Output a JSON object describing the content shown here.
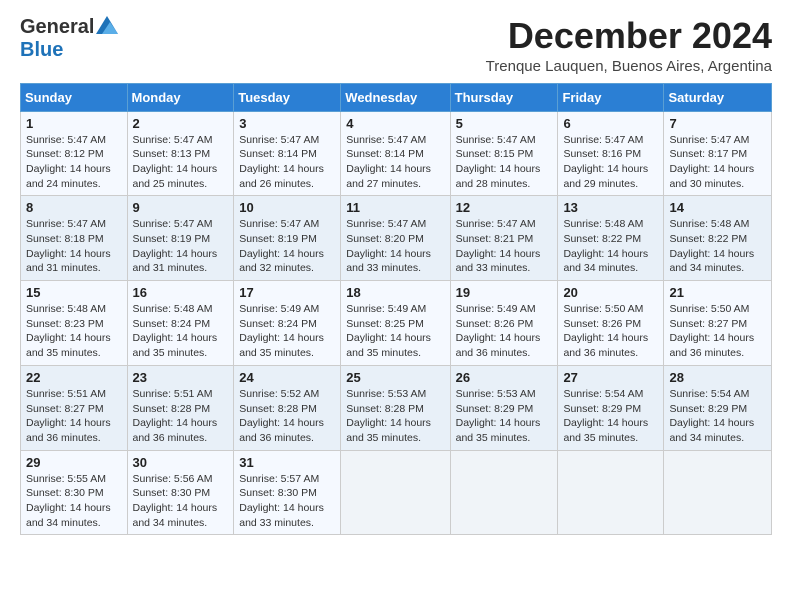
{
  "header": {
    "logo_general": "General",
    "logo_blue": "Blue",
    "title": "December 2024",
    "location": "Trenque Lauquen, Buenos Aires, Argentina"
  },
  "calendar": {
    "days_of_week": [
      "Sunday",
      "Monday",
      "Tuesday",
      "Wednesday",
      "Thursday",
      "Friday",
      "Saturday"
    ],
    "weeks": [
      [
        {
          "day": "1",
          "sunrise": "5:47 AM",
          "sunset": "8:12 PM",
          "daylight": "14 hours and 24 minutes."
        },
        {
          "day": "2",
          "sunrise": "5:47 AM",
          "sunset": "8:13 PM",
          "daylight": "14 hours and 25 minutes."
        },
        {
          "day": "3",
          "sunrise": "5:47 AM",
          "sunset": "8:14 PM",
          "daylight": "14 hours and 26 minutes."
        },
        {
          "day": "4",
          "sunrise": "5:47 AM",
          "sunset": "8:14 PM",
          "daylight": "14 hours and 27 minutes."
        },
        {
          "day": "5",
          "sunrise": "5:47 AM",
          "sunset": "8:15 PM",
          "daylight": "14 hours and 28 minutes."
        },
        {
          "day": "6",
          "sunrise": "5:47 AM",
          "sunset": "8:16 PM",
          "daylight": "14 hours and 29 minutes."
        },
        {
          "day": "7",
          "sunrise": "5:47 AM",
          "sunset": "8:17 PM",
          "daylight": "14 hours and 30 minutes."
        }
      ],
      [
        {
          "day": "8",
          "sunrise": "5:47 AM",
          "sunset": "8:18 PM",
          "daylight": "14 hours and 31 minutes."
        },
        {
          "day": "9",
          "sunrise": "5:47 AM",
          "sunset": "8:19 PM",
          "daylight": "14 hours and 31 minutes."
        },
        {
          "day": "10",
          "sunrise": "5:47 AM",
          "sunset": "8:19 PM",
          "daylight": "14 hours and 32 minutes."
        },
        {
          "day": "11",
          "sunrise": "5:47 AM",
          "sunset": "8:20 PM",
          "daylight": "14 hours and 33 minutes."
        },
        {
          "day": "12",
          "sunrise": "5:47 AM",
          "sunset": "8:21 PM",
          "daylight": "14 hours and 33 minutes."
        },
        {
          "day": "13",
          "sunrise": "5:48 AM",
          "sunset": "8:22 PM",
          "daylight": "14 hours and 34 minutes."
        },
        {
          "day": "14",
          "sunrise": "5:48 AM",
          "sunset": "8:22 PM",
          "daylight": "14 hours and 34 minutes."
        }
      ],
      [
        {
          "day": "15",
          "sunrise": "5:48 AM",
          "sunset": "8:23 PM",
          "daylight": "14 hours and 35 minutes."
        },
        {
          "day": "16",
          "sunrise": "5:48 AM",
          "sunset": "8:24 PM",
          "daylight": "14 hours and 35 minutes."
        },
        {
          "day": "17",
          "sunrise": "5:49 AM",
          "sunset": "8:24 PM",
          "daylight": "14 hours and 35 minutes."
        },
        {
          "day": "18",
          "sunrise": "5:49 AM",
          "sunset": "8:25 PM",
          "daylight": "14 hours and 35 minutes."
        },
        {
          "day": "19",
          "sunrise": "5:49 AM",
          "sunset": "8:26 PM",
          "daylight": "14 hours and 36 minutes."
        },
        {
          "day": "20",
          "sunrise": "5:50 AM",
          "sunset": "8:26 PM",
          "daylight": "14 hours and 36 minutes."
        },
        {
          "day": "21",
          "sunrise": "5:50 AM",
          "sunset": "8:27 PM",
          "daylight": "14 hours and 36 minutes."
        }
      ],
      [
        {
          "day": "22",
          "sunrise": "5:51 AM",
          "sunset": "8:27 PM",
          "daylight": "14 hours and 36 minutes."
        },
        {
          "day": "23",
          "sunrise": "5:51 AM",
          "sunset": "8:28 PM",
          "daylight": "14 hours and 36 minutes."
        },
        {
          "day": "24",
          "sunrise": "5:52 AM",
          "sunset": "8:28 PM",
          "daylight": "14 hours and 36 minutes."
        },
        {
          "day": "25",
          "sunrise": "5:53 AM",
          "sunset": "8:28 PM",
          "daylight": "14 hours and 35 minutes."
        },
        {
          "day": "26",
          "sunrise": "5:53 AM",
          "sunset": "8:29 PM",
          "daylight": "14 hours and 35 minutes."
        },
        {
          "day": "27",
          "sunrise": "5:54 AM",
          "sunset": "8:29 PM",
          "daylight": "14 hours and 35 minutes."
        },
        {
          "day": "28",
          "sunrise": "5:54 AM",
          "sunset": "8:29 PM",
          "daylight": "14 hours and 34 minutes."
        }
      ],
      [
        {
          "day": "29",
          "sunrise": "5:55 AM",
          "sunset": "8:30 PM",
          "daylight": "14 hours and 34 minutes."
        },
        {
          "day": "30",
          "sunrise": "5:56 AM",
          "sunset": "8:30 PM",
          "daylight": "14 hours and 34 minutes."
        },
        {
          "day": "31",
          "sunrise": "5:57 AM",
          "sunset": "8:30 PM",
          "daylight": "14 hours and 33 minutes."
        },
        null,
        null,
        null,
        null
      ]
    ]
  }
}
